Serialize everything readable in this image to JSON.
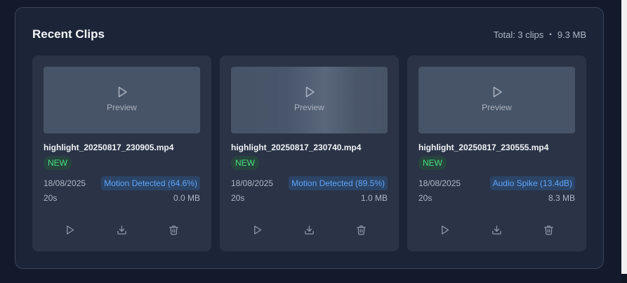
{
  "panel": {
    "title": "Recent Clips",
    "total_label": "Total: 3 clips",
    "separator": "•",
    "total_size": "9.3 MB"
  },
  "clips": [
    {
      "preview_label": "Preview",
      "filename": "highlight_20250817_230905.mp4",
      "badge": "NEW",
      "date": "18/08/2025",
      "event": "Motion Detected (64.6%)",
      "duration": "20s",
      "size": "0.0 MB"
    },
    {
      "preview_label": "Preview",
      "filename": "highlight_20250817_230740.mp4",
      "badge": "NEW",
      "date": "18/08/2025",
      "event": "Motion Detected (89.5%)",
      "duration": "20s",
      "size": "1.0 MB"
    },
    {
      "preview_label": "Preview",
      "filename": "highlight_20250817_230555.mp4",
      "badge": "NEW",
      "date": "18/08/2025",
      "event": "Audio Spike (13.4dB)",
      "duration": "20s",
      "size": "8.3 MB"
    }
  ],
  "icons": {
    "preview": "play-icon",
    "play": "play-icon",
    "download": "download-icon",
    "delete": "trash-icon"
  },
  "colors": {
    "new_badge": "#4ade80",
    "event_tag": "#60a5fa"
  }
}
